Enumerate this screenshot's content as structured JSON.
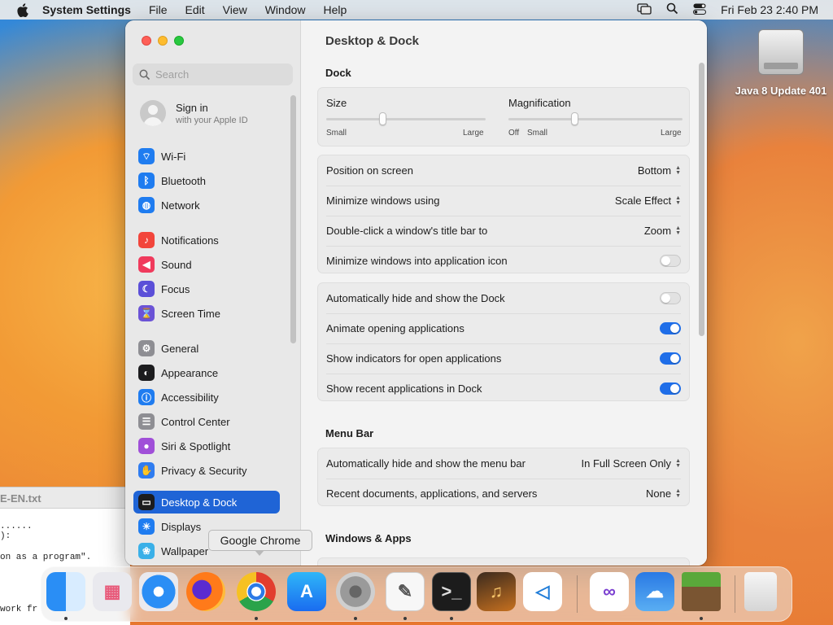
{
  "menubar": {
    "app_name": "System Settings",
    "items": [
      "File",
      "Edit",
      "View",
      "Window",
      "Help"
    ],
    "clock": "Fri Feb 23  2:40 PM"
  },
  "desktop": {
    "drive_label": "Java 8 Update 401"
  },
  "editor": {
    "title": "E-EN.txt",
    "lines": [
      "......",
      "):",
      "on as a program\".",
      "work fr"
    ]
  },
  "sidebar": {
    "search_placeholder": "Search",
    "signin_title": "Sign in",
    "signin_subtitle": "with your Apple ID",
    "items": [
      {
        "label": "Wi-Fi",
        "icon": "wifi-icon",
        "color": "#1f7cf0"
      },
      {
        "label": "Bluetooth",
        "icon": "bluetooth-icon",
        "color": "#1f7cf0"
      },
      {
        "label": "Network",
        "icon": "globe-icon",
        "color": "#1f7cf0"
      },
      {
        "label": "Notifications",
        "icon": "bell-icon",
        "color": "#f2453b"
      },
      {
        "label": "Sound",
        "icon": "speaker-icon",
        "color": "#f03a5c"
      },
      {
        "label": "Focus",
        "icon": "moon-icon",
        "color": "#5b4fd8"
      },
      {
        "label": "Screen Time",
        "icon": "hourglass-icon",
        "color": "#6b53d6"
      },
      {
        "label": "General",
        "icon": "gear-icon",
        "color": "#8e8e93"
      },
      {
        "label": "Appearance",
        "icon": "appearance-icon",
        "color": "#1c1c1e"
      },
      {
        "label": "Accessibility",
        "icon": "accessibility-icon",
        "color": "#1f7cf0"
      },
      {
        "label": "Control Center",
        "icon": "control-center-icon",
        "color": "#8e8e93"
      },
      {
        "label": "Siri & Spotlight",
        "icon": "siri-icon",
        "color": "#a04fd8"
      },
      {
        "label": "Privacy & Security",
        "icon": "hand-icon",
        "color": "#2f7cf0"
      },
      {
        "label": "Desktop & Dock",
        "icon": "dock-icon",
        "color": "#1c1c1e"
      },
      {
        "label": "Displays",
        "icon": "display-icon",
        "color": "#1f7cf0"
      },
      {
        "label": "Wallpaper",
        "icon": "wallpaper-icon",
        "color": "#3ab0e8"
      }
    ]
  },
  "content": {
    "page_title": "Desktop & Dock",
    "dock_section": "Dock",
    "size_label": "Size",
    "size_small": "Small",
    "size_large": "Large",
    "size_value": 0.35,
    "mag_label": "Magnification",
    "mag_off": "Off",
    "mag_small": "Small",
    "mag_large": "Large",
    "mag_value": 0.38,
    "rows1": [
      {
        "label": "Position on screen",
        "value": "Bottom"
      },
      {
        "label": "Minimize windows using",
        "value": "Scale Effect"
      },
      {
        "label": "Double-click a window's title bar to",
        "value": "Zoom"
      },
      {
        "label": "Minimize windows into application icon",
        "toggle": false
      }
    ],
    "rows2": [
      {
        "label": "Automatically hide and show the Dock",
        "toggle": false
      },
      {
        "label": "Animate opening applications",
        "toggle": true
      },
      {
        "label": "Show indicators for open applications",
        "toggle": true
      },
      {
        "label": "Show recent applications in Dock",
        "toggle": true
      }
    ],
    "menubar_section": "Menu Bar",
    "rows3": [
      {
        "label": "Automatically hide and show the menu bar",
        "value": "In Full Screen Only"
      },
      {
        "label": "Recent documents, applications, and servers",
        "value": "None"
      }
    ],
    "windows_section": "Windows & Apps"
  },
  "tooltip": "Google Chrome",
  "dock": {
    "apps": [
      {
        "name": "Finder",
        "icon": "finder-icon",
        "running": true
      },
      {
        "name": "Launchpad",
        "icon": "launchpad-icon",
        "running": false
      },
      {
        "name": "Safari",
        "icon": "safari-icon",
        "running": false
      },
      {
        "name": "Firefox",
        "icon": "firefox-icon",
        "running": false
      },
      {
        "name": "Google Chrome",
        "icon": "chrome-icon",
        "running": true
      },
      {
        "name": "App Store",
        "icon": "app-store-icon",
        "running": false
      },
      {
        "name": "System Settings",
        "icon": "system-settings-icon",
        "running": true
      },
      {
        "name": "TextEdit",
        "icon": "textedit-icon",
        "running": true
      },
      {
        "name": "Terminal",
        "icon": "terminal-icon",
        "running": true
      },
      {
        "name": "GarageBand",
        "icon": "garageband-icon",
        "running": false
      },
      {
        "name": "Visual Studio Code",
        "icon": "vscode-icon",
        "running": false
      },
      {
        "name": "Visual Studio",
        "icon": "visual-studio-icon",
        "running": false
      },
      {
        "name": "Weather",
        "icon": "weather-icon",
        "running": false
      },
      {
        "name": "Minecraft",
        "icon": "minecraft-icon",
        "running": true
      },
      {
        "name": "Trash",
        "icon": "trash-icon",
        "running": false
      }
    ]
  }
}
